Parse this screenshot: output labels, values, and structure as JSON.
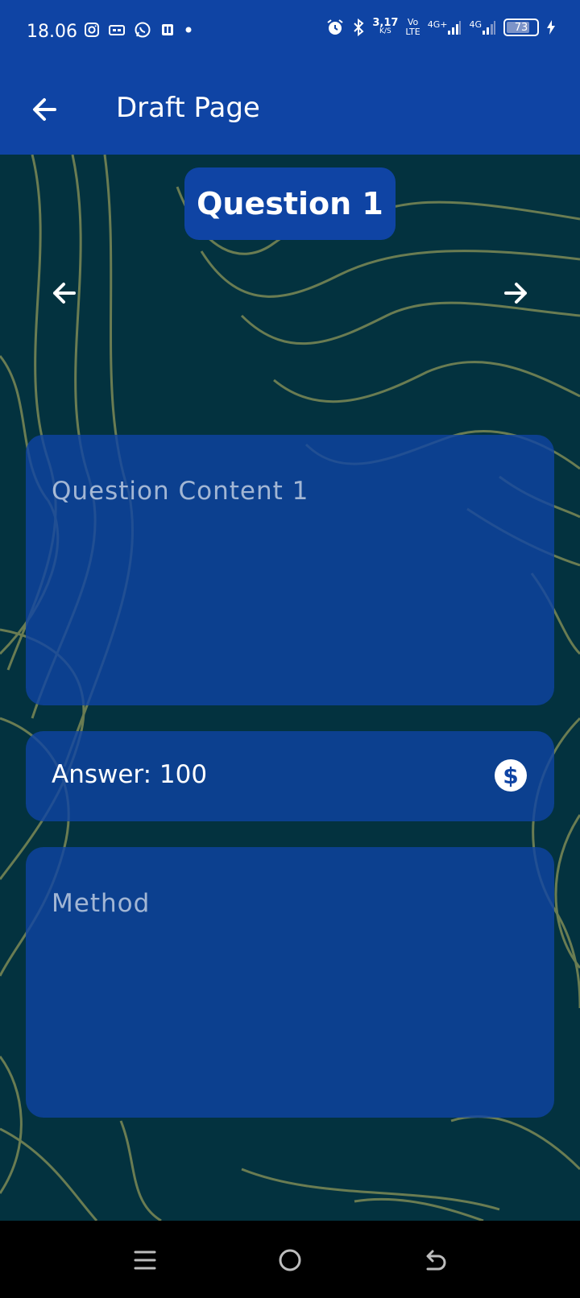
{
  "status_bar": {
    "time": "18.06",
    "net_speed": "3,17",
    "net_speed_unit": "K/S",
    "volte": "Vo",
    "lte": "LTE",
    "sig1": "4G+",
    "sig2": "4G",
    "battery": "73"
  },
  "app_bar": {
    "title": "Draft Page"
  },
  "question": {
    "label": "Question 1",
    "content_placeholder": "Question Content 1",
    "answer_text": "Answer: 100",
    "method_placeholder": "Method"
  },
  "colors": {
    "primary": "#0f44a4",
    "background": "#03323f",
    "contour": "#7d8a56"
  },
  "icons": {
    "back": "arrow-left-icon",
    "prev": "arrow-left-icon",
    "next": "arrow-right-icon",
    "answer": "dollar-coin-icon",
    "nav_menu": "menu-icon",
    "nav_home": "home-circle-icon",
    "nav_back": "back-icon"
  }
}
